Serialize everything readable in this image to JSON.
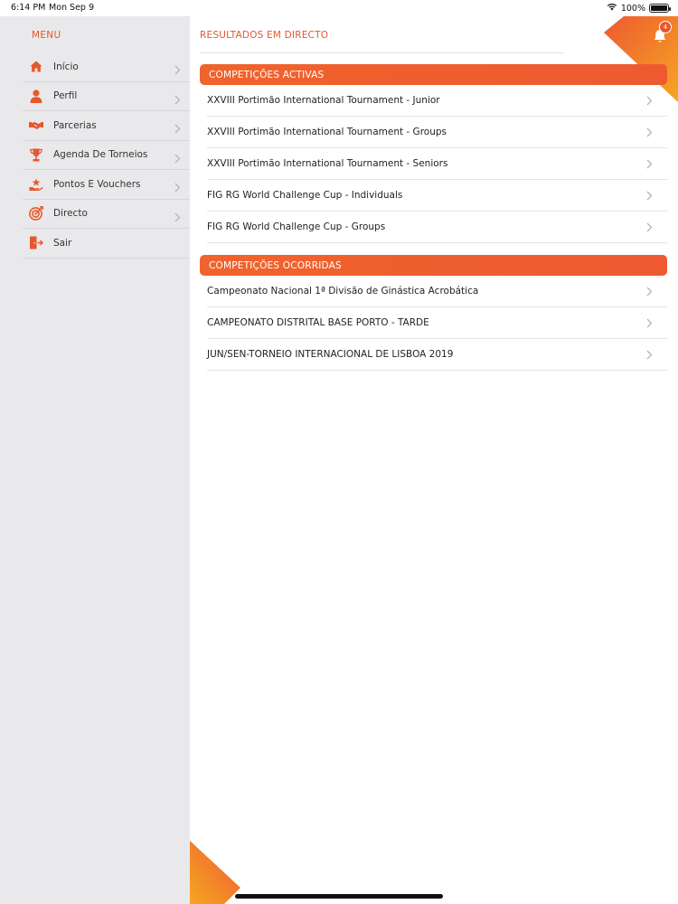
{
  "status_bar": {
    "time": "6:14 PM",
    "date": "Mon Sep 9",
    "battery": "100%",
    "battery_level": 1.0
  },
  "colors": {
    "accent": "#e8572c",
    "accent_light": "#f5a623",
    "sidebar_bg": "#e9e9eb"
  },
  "sidebar": {
    "title": "MENU",
    "items": [
      {
        "label": "Início",
        "icon": "home-icon"
      },
      {
        "label": "Perfil",
        "icon": "user-icon"
      },
      {
        "label": "Parcerias",
        "icon": "handshake-icon"
      },
      {
        "label": "Agenda De Torneios",
        "icon": "trophy-icon"
      },
      {
        "label": "Pontos E Vouchers",
        "icon": "star-hand-icon"
      },
      {
        "label": "Directo",
        "icon": "target-icon"
      },
      {
        "label": "Sair",
        "icon": "logout-icon"
      }
    ]
  },
  "header": {
    "title": "RESULTADOS EM DIRECTO",
    "notifications_count": "4"
  },
  "active_section": {
    "title": "COMPETIÇÕES ACTIVAS",
    "items": [
      "XXVIII Portimão International Tournament - Junior",
      "XXVIII Portimão International Tournament - Groups",
      "XXVIII Portimão International Tournament - Seniors",
      "FIG RG World Challenge Cup - Individuals",
      "FIG RG World Challenge Cup - Groups"
    ]
  },
  "past_section": {
    "title": "COMPETIÇÕES OCORRIDAS",
    "items": [
      "Campeonato Nacional 1ª Divisão de Ginástica Acrobática",
      "CAMPEONATO DISTRITAL BASE PORTO - TARDE",
      "JUN/SEN-TORNEIO INTERNACIONAL DE LISBOA 2019"
    ]
  }
}
